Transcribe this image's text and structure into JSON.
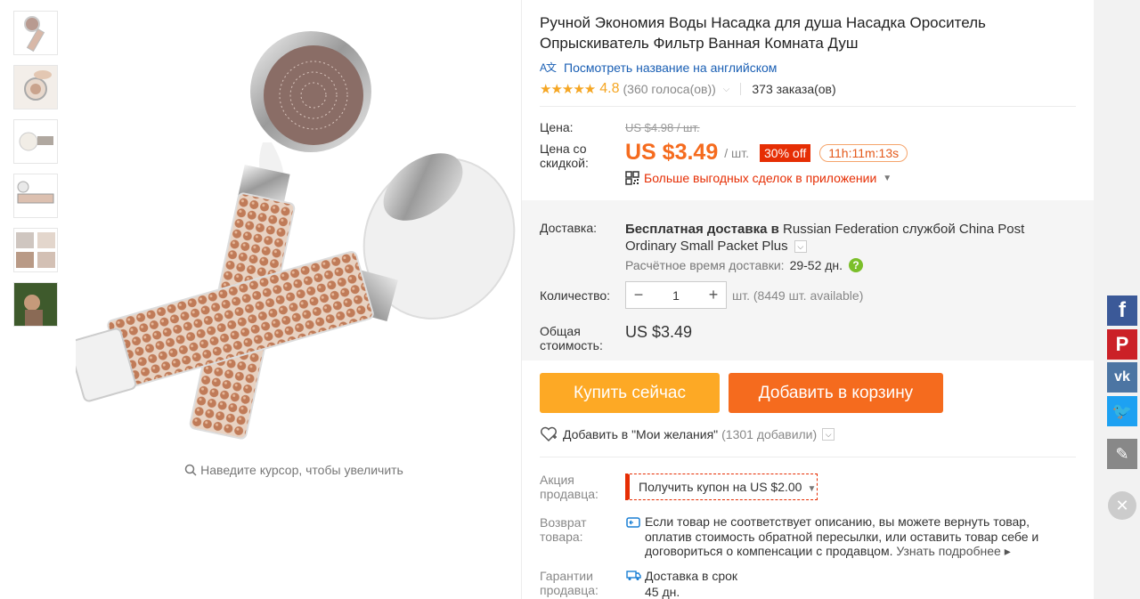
{
  "product": {
    "title": "Ручной Экономия Воды Насадка для душа Насадка Ороситель Опрыскиватель Фильтр Ванная Комната Душ",
    "translate_link": "Посмотреть название на английском",
    "translate_icon": "translate-icon",
    "stars": "★★★★★",
    "rating": "4.8",
    "votes": "(360 голоса(ов))",
    "orders": "373 заказа(ов)"
  },
  "price": {
    "price_label": "Цена:",
    "old_price": "US $4.98 / шт.",
    "discount_label": "Цена со скидкой:",
    "new_price": "US $3.49",
    "unit": "/ шт.",
    "off_badge": "30% off",
    "timer": "11h:11m:13s",
    "app_deals": "Больше выгодных сделок в приложении"
  },
  "shipping": {
    "label": "Доставка:",
    "free_text": "Бесплатная доставка в",
    "rest_text": " Russian Federation службой China Post Ordinary Small Packet Plus",
    "eta_label": "Расчётное время доставки:",
    "eta_days": "29-52 дн.",
    "help": "?"
  },
  "quantity": {
    "label": "Количество:",
    "minus": "−",
    "value": "1",
    "plus": "+",
    "available": "шт. (8449 шт. available)"
  },
  "total": {
    "label": "Общая стоимость:",
    "value": "US $3.49"
  },
  "actions": {
    "buy_now": "Купить сейчас",
    "add_to_cart": "Добавить в корзину",
    "wishlist": "Добавить в \"Мои желания\"",
    "wishlist_count": "(1301 добавили)"
  },
  "promo": {
    "label": "Акция продавца:",
    "coupon": "Получить купон на US $2.00"
  },
  "returns": {
    "label": "Возврат товара:",
    "text": "Если товар не соответствует описанию, вы можете вернуть товар, оплатив стоимость обратной пересылки, или оставить товар себе и договориться о компенсации с продавцом.",
    "more": "Узнать подробнее ▸"
  },
  "guarantee": {
    "label": "Гарантии продавца:",
    "line1": "Доставка в срок",
    "line2": "45 дн."
  },
  "gallery": {
    "zoom_hint": "Наведите курсор, чтобы увеличить"
  },
  "social": {
    "facebook": "f",
    "pinterest": "P",
    "vk": "vk",
    "twitter": "🐦",
    "edit": "✎",
    "close": "✕"
  },
  "colors": {
    "price_orange": "#f56b1e",
    "buy_yellow": "#fda925",
    "badge_red": "#e62e04",
    "link_blue": "#1a5fb4",
    "star_gold": "#f5a623"
  }
}
